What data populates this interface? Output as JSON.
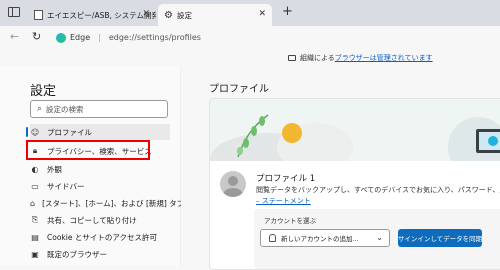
{
  "tabs": [
    {
      "title": "エイエスピー/ASB, システム開発, ソフ",
      "close": "✕"
    },
    {
      "title": "設定",
      "close": "✕"
    }
  ],
  "new_tab": "+",
  "address": {
    "browser": "Edge",
    "separator": "|",
    "path": "edge://settings/profiles"
  },
  "managed_notice": {
    "prefix": "組織による",
    "link": "ブラウザーは管理されています"
  },
  "sidebar": {
    "title": "設定",
    "search_placeholder": "設定の検索",
    "items": [
      {
        "label": "プロファイル",
        "icon": "person-icon",
        "selected": true
      },
      {
        "label": "プライバシー、検索、サービス",
        "icon": "lock-icon"
      },
      {
        "label": "外観",
        "icon": "appearance-icon"
      },
      {
        "label": "サイドバー",
        "icon": "sidebar-icon"
      },
      {
        "label": "[スタート]、[ホーム]、および [新規] タブ",
        "icon": "home-icon"
      },
      {
        "label": "共有、コピーして貼り付け",
        "icon": "share-icon"
      },
      {
        "label": "Cookie とサイトのアクセス許可",
        "icon": "cookie-icon"
      },
      {
        "label": "既定のブラウザー",
        "icon": "browser-icon"
      }
    ]
  },
  "main": {
    "title": "プロファイル",
    "profile_name": "プロファイル 1",
    "description": "閲覧データをバックアップし、すべてのデバイスでお気に入り、パスワード、履歴などを表示",
    "statement_link": "ステートメント",
    "account_label": "アカウントを選ぶ",
    "account_select": "新しいアカウントの追加...",
    "sync_button": "サインインしてデータを同期"
  },
  "colors": {
    "accent": "#0f6cbd",
    "highlight_box": "#e00000",
    "tab_strip": "#d9dde3"
  }
}
